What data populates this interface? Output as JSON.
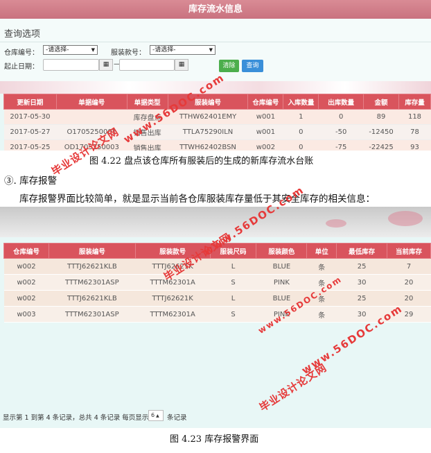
{
  "top": {
    "title": "库存流水信息",
    "panel_title": "查询选项",
    "warehouse_label": "仓库编号：",
    "warehouse_value": "-请选择-",
    "style_label": "服装款号：",
    "style_value": "-请选择-",
    "date_label": "起止日期：",
    "date_sep": "—",
    "clear_btn": "清除",
    "query_btn": "查询",
    "table": {
      "headers": [
        "更新日期",
        "单据编号",
        "单据类型",
        "服装编号",
        "仓库编号",
        "入库数量",
        "出库数量",
        "金额",
        "库存量"
      ],
      "rows": [
        [
          "2017-05-30",
          "",
          "库存盘点",
          "TTHW62401EMY",
          "w001",
          "1",
          "0",
          "89",
          "118"
        ],
        [
          "2017-05-27",
          "O1705250001",
          "销售出库",
          "TTLA75290ILN",
          "w001",
          "0",
          "-50",
          "-12450",
          "78"
        ],
        [
          "2017-05-25",
          "OD1705250003",
          "销售出库",
          "TTWH62402BSN",
          "w002",
          "0",
          "-75",
          "-22425",
          "93"
        ]
      ]
    }
  },
  "caption1": "图 4.22 盘点该仓库所有服装后的生成的新库存流水台账",
  "section_title": "③. 库存报警",
  "section_text": "库存报警界面比较简单，就是显示当前各仓库服装库存量低于其安全库存的相关信息：",
  "bottom": {
    "table": {
      "headers": [
        "仓库编号",
        "服装编号",
        "服装款号",
        "服装尺码",
        "服装颜色",
        "单位",
        "最低库存",
        "当前库存"
      ],
      "rows": [
        [
          "w002",
          "TTTJ62621KLB",
          "TTTJ62621K",
          "L",
          "BLUE",
          "条",
          "25",
          "7"
        ],
        [
          "w002",
          "TTTM62301ASP",
          "TTTM62301A",
          "S",
          "PINK",
          "条",
          "30",
          "20"
        ],
        [
          "w002",
          "TTTJ62621KLB",
          "TTTJ62621K",
          "L",
          "BLUE",
          "条",
          "25",
          "20"
        ],
        [
          "w003",
          "TTTM62301ASP",
          "TTTM62301A",
          "S",
          "PINK",
          "条",
          "30",
          "29"
        ]
      ]
    },
    "pager_text": "显示第 1 到第 4 条记录，总共 4 条记录 每页显示",
    "pager_size": "6",
    "pager_tail": "条记录"
  },
  "caption2": "图 4.23 库存报警界面",
  "watermark": {
    "text": "毕业设计论文网",
    "url": "www.56DOC.com"
  },
  "colors": {
    "header_red": "#d9545d",
    "title_bar": "#c9727f",
    "btn_clear": "#4cae4c",
    "btn_query": "#3a8fd9",
    "watermark": "#e63a3a"
  }
}
